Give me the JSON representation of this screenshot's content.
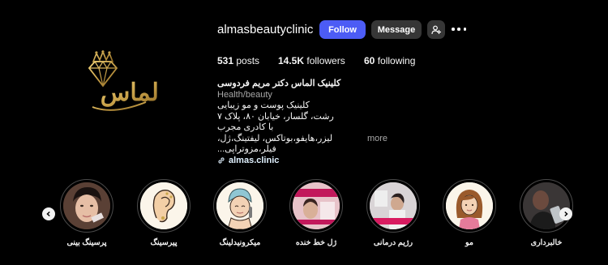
{
  "profile": {
    "username": "almasbeautyclinic",
    "follow_label": "Follow",
    "message_label": "Message",
    "logo_text": "الماس",
    "posts_count": "531",
    "posts_label": "posts",
    "followers_count": "14.5K",
    "followers_label": "followers",
    "following_count": "60",
    "following_label": "following"
  },
  "bio": {
    "name": "کلینیک الماس دکتر مریم فردوسی",
    "category": "Health/beauty",
    "lines": [
      "کلینیک پوست و مو زیبایی",
      "رشت، گلسار، خیابان ۸۰، پلاک ۷",
      "با کادری مجرب"
    ],
    "last_line": "لیزر،هایفو،بوتاکس، لیفتینگ،ژل، فیلر،مزوتراپی...",
    "more_label": "more",
    "link_text": "almas.clinic"
  },
  "highlights": [
    {
      "label": "پرسینگ بینی",
      "icon": "portrait-photo"
    },
    {
      "label": "پیرسینگ",
      "icon": "ear-illustration"
    },
    {
      "label": "میکرونیدلینگ",
      "icon": "towel-face-illustration"
    },
    {
      "label": "ژل خط خنده",
      "icon": "promo-photo"
    },
    {
      "label": "رژیم درمانی",
      "icon": "clinic-photo"
    },
    {
      "label": "مو",
      "icon": "hair-illustration"
    },
    {
      "label": "خالبرداری",
      "icon": "phone-photo"
    }
  ],
  "colors": {
    "background": "#000000",
    "follow_button": "#4c5cf5",
    "secondary_button": "#363636",
    "logo_gold": "#c9a24a",
    "muted_text": "#a8a8a8",
    "link_text": "#e0f1ff"
  }
}
